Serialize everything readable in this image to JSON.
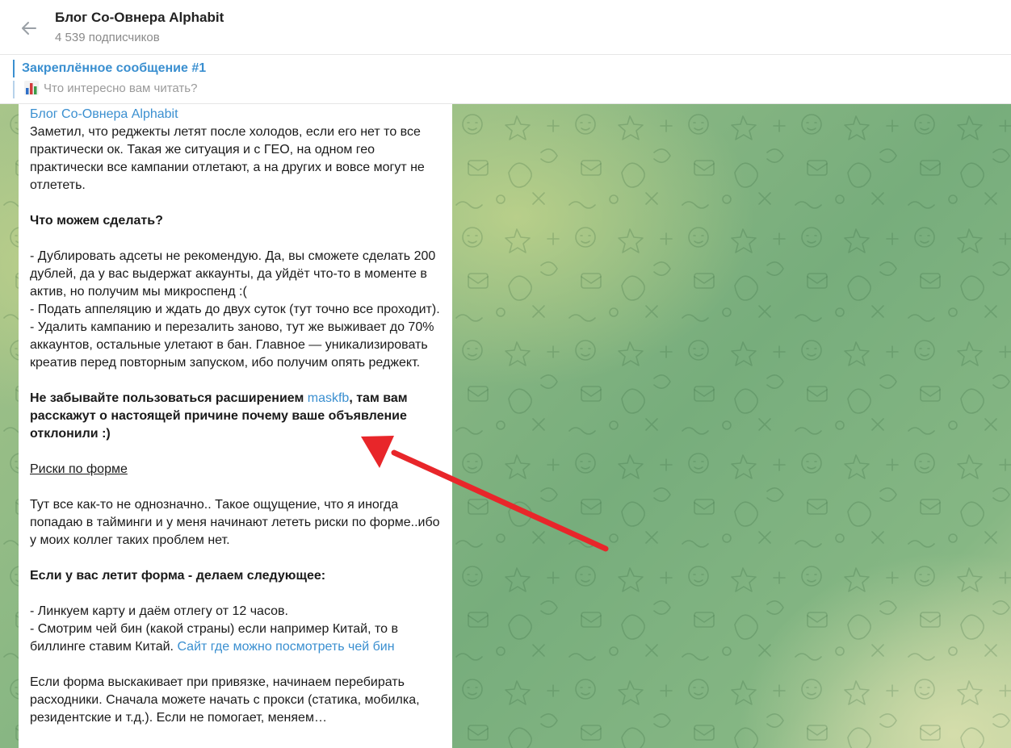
{
  "header": {
    "title": "Блог Со-Овнера Alphabit",
    "subscribers": "4 539 подписчиков"
  },
  "pinned": {
    "title": "Закреплённое сообщение #1",
    "text": "Что интересно вам читать?",
    "icon": "bar-chart-icon"
  },
  "message": {
    "author": "Блог Со-Овнера Alphabit",
    "p1": "Заметил, что реджекты летят после холодов, если его нет то все практически ок. Такая же ситуация и с ГЕО, на одном гео практически все кампании отлетают, а на других и вовсе могут не отлететь.",
    "h1": "Что можем сделать?",
    "l1": "- Дублировать адсеты не рекомендую. Да, вы сможете сделать 200 дублей, да у вас выдержат аккаунты, да уйдёт что-то в моменте в актив, но получим мы микроспенд :(",
    "l2": "- Подать аппеляцию и ждать до двух суток (тут точно все проходит).",
    "l3": "- Удалить кампанию и перезалить заново, тут же выживает до 70% аккаунтов, остальные улетают в бан. Главное — уникализировать креатив перед повторным запуском, ибо получим опять реджект.",
    "bold_pre": "Не забывайте пользоваться расширением ",
    "bold_link": "maskfb",
    "bold_post": ", там вам расскажут о настоящей причине почему ваше объявление отклонили :)",
    "h2": "Риски по форме",
    "p2": "Тут все как-то не однозначно.. Такое ощущение, что я иногда попадаю в тайминги и у меня начинают лететь риски по форме..ибо у моих коллег таких проблем нет.",
    "h3": "Если у вас летит форма - делаем следующее:",
    "l4": "- Линкуем карту и даём отлегу от 12 часов.",
    "l5": "- Смотрим чей бин (какой страны) если например Китай, то в биллинге ставим Китай. ",
    "l5_link": "Сайт где можно посмотреть чей бин",
    "p3": "Если форма выскакивает при привязке, начинаем перебирать расходники. Сначала можете начать с прокси (статика, мобилка, резидентские и т.д.). Если не помогает, меняем…"
  },
  "colors": {
    "accent": "#3a8fd0",
    "arrow": "#e8262a",
    "chat_bg": "#86b784"
  }
}
